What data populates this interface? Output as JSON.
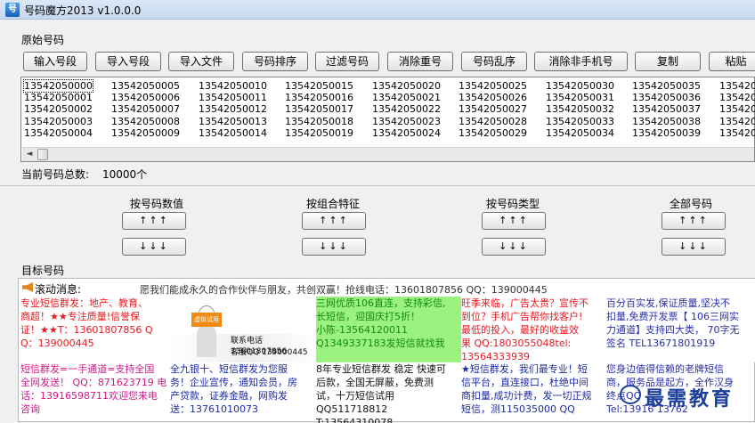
{
  "window": {
    "title": "号码魔方2013  v1.0.0.0",
    "icon": "app-logo-icon"
  },
  "source_section": {
    "label": "原始号码"
  },
  "toolbar": [
    {
      "label": "输入号段"
    },
    {
      "label": "导入号段"
    },
    {
      "label": "导入文件"
    },
    {
      "label": "号码排序"
    },
    {
      "label": "过滤号码"
    },
    {
      "label": "消除重号"
    },
    {
      "label": "号码乱序"
    },
    {
      "label": "消除非手机号"
    },
    {
      "label": "复制"
    },
    {
      "label": "粘贴"
    }
  ],
  "number_list": {
    "columns": [
      [
        "13542050000",
        "13542050001",
        "13542050002",
        "13542050003",
        "13542050004"
      ],
      [
        "13542050005",
        "13542050006",
        "13542050007",
        "13542050008",
        "13542050009"
      ],
      [
        "13542050010",
        "13542050011",
        "13542050012",
        "13542050013",
        "13542050014"
      ],
      [
        "13542050015",
        "13542050016",
        "13542050017",
        "13542050018",
        "13542050019"
      ],
      [
        "13542050020",
        "13542050021",
        "13542050022",
        "13542050023",
        "13542050024"
      ],
      [
        "13542050025",
        "13542050026",
        "13542050027",
        "13542050028",
        "13542050029"
      ],
      [
        "13542050030",
        "13542050031",
        "13542050032",
        "13542050033",
        "13542050034"
      ],
      [
        "13542050035",
        "13542050036",
        "13542050037",
        "13542050038",
        "13542050039"
      ],
      [
        "13542050040",
        "13542050041",
        "13542050042",
        "13542050043",
        "13542050044"
      ]
    ],
    "scroll_left": "◄"
  },
  "count": {
    "label": "当前号码总数:",
    "value": "10000个"
  },
  "sort_groups": [
    {
      "label": "按号码数值",
      "up": "↑↑↑",
      "down": "↓↓↓"
    },
    {
      "label": "按组合特征",
      "up": "↑↑↑",
      "down": "↓↓↓"
    },
    {
      "label": "按号码类型",
      "up": "↑↑↑",
      "down": "↓↓↓"
    },
    {
      "label": "全部号码",
      "up": "↑↑↑",
      "down": "↓↓↓"
    }
  ],
  "target_section": {
    "label": "目标号码"
  },
  "ticker": {
    "label": "滚动消息:",
    "text": "愿我们能成永久的合作伙伴与朋友，共创双赢！抢线电话：13601807856 QQ：139000445"
  },
  "ads": [
    {
      "lines": [
        "专业短信群发：地产、教育、",
        "商超！★★专注质量!信誉保",
        "证！★★T：13601807856 Q",
        "Q：139000445"
      ]
    },
    {
      "lines": [
        "联系电话 13601807856",
        "客服QQ 139000445"
      ],
      "sign": "虚拟试用"
    },
    {
      "lines": [
        "三网优质106直连，支持彩信,",
        "长短信，迎国庆打5折！",
        "小陈-13564120011",
        "Q1349337183发短信就找我"
      ]
    },
    {
      "lines": [
        "旺季来临，广告太贵？宣传不",
        "到位？手机广告帮你找客户!",
        "最低的投入，最好的收益效",
        "果 QQ:1803055048tel:",
        "13564333939"
      ]
    },
    {
      "lines": [
        "百分百实发,保证质量,坚决不",
        "扣量,免费开发票【 106三网实",
        "力通道】支持四大类， 70字无",
        "签名 TEL13671801919"
      ]
    },
    {
      "lines": [
        "短信群发=一手通道=支持全国",
        "全网发送！ QQ：871623719 电",
        "话：13916598711欢迎您来电",
        "咨询"
      ]
    },
    {
      "lines": [
        "全九银十、短信群发为您服",
        "务！企业宣传，通知会员，房",
        "产贷款，证券金融，网购发",
        "送：13761010073"
      ]
    },
    {
      "lines": [
        "8年专业短信群发 稳定 快速可",
        "后款，全国无屏蔽，免费测",
        "试，十万短信试用",
        "QQ511718812 T:13564310078"
      ]
    },
    {
      "lines": [
        "★短信群发，我们最专业！短",
        "信平台，直连接口，杜绝中间",
        "商扣量,成功计费，发一切正规",
        "短信，测115035000 QQ"
      ]
    },
    {
      "lines": [
        "您身边值得信赖的老牌短信",
        "商，服务品是起方，全作汉身",
        "终点QQ",
        "Tel:13916 13762"
      ]
    }
  ],
  "watermark": "最需教育"
}
